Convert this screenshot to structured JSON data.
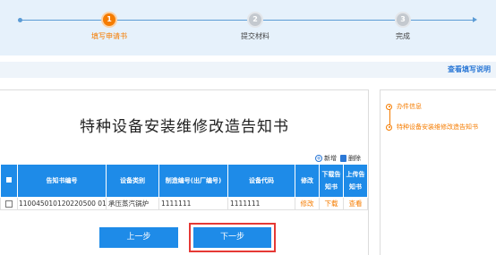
{
  "stepper": {
    "steps": [
      {
        "number": "1",
        "label": "填写申请书",
        "state": "active"
      },
      {
        "number": "2",
        "label": "提交材料",
        "state": "todo"
      },
      {
        "number": "3",
        "label": "完成",
        "state": "todo"
      }
    ]
  },
  "guide": {
    "link_label": "查看填写说明"
  },
  "document": {
    "title": "特种设备安装维修改造告知书",
    "actions": {
      "add_label": "新增",
      "delete_label": "删除"
    }
  },
  "table": {
    "headers": [
      "告知书编号",
      "设备类别",
      "制造编号(出厂编号)",
      "设备代码",
      "修改",
      "下载告知书",
      "上传告知书"
    ],
    "rows": [
      {
        "id": "110045010120220500 01",
        "category": "承压蒸汽锅炉",
        "serial": "1111111",
        "code": "1111111",
        "edit": "修改",
        "download": "下载",
        "upload": "查看"
      }
    ]
  },
  "buttons": {
    "prev_label": "上一步",
    "next_label": "下一步"
  },
  "side_nav": {
    "items": [
      {
        "label": "办件信息"
      },
      {
        "label": "特种设备安装维修改造告知书"
      }
    ]
  },
  "colors": {
    "accent": "#1e8be8",
    "active": "#f57c00",
    "highlight": "#e53935"
  }
}
